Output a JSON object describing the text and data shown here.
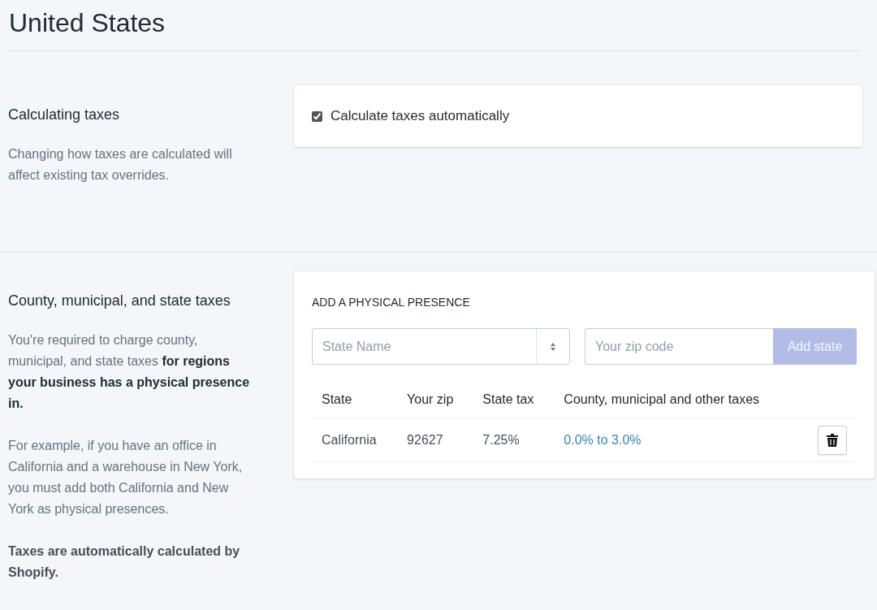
{
  "page_title": "United States",
  "sections": [
    {
      "heading": "Calculating taxes",
      "paragraphs": [
        {
          "text": "Changing how taxes are calculated will affect existing tax overrides.",
          "bold": false
        }
      ],
      "kind": "checkbox",
      "checkbox": {
        "label": "Calculate taxes automatically",
        "checked": true
      }
    },
    {
      "heading": "County, municipal, and state taxes",
      "paragraphs": [
        {
          "text": "You're required to charge county, municipal, and state taxes **for regions your business has a physical presence in.**",
          "bold": false
        },
        {
          "text": "For example, if you have an office in California and a warehouse in New York, you must add both California and New York as physical presences.",
          "bold": false
        },
        {
          "text": "Taxes are automatically calculated by Shopify.",
          "bold": true
        }
      ],
      "kind": "presence",
      "presence": {
        "title": "ADD A PHYSICAL PRESENCE",
        "state_select": {
          "placeholder": "State Name"
        },
        "zip_field": {
          "placeholder": "Your zip code"
        },
        "add_button": {
          "label": "Add state",
          "disabled": true
        },
        "columns": [
          "State",
          "Your zip",
          "State tax",
          "County, municipal and other taxes"
        ],
        "rows": [
          {
            "state": "California",
            "zip": "92627",
            "state_tax": "7.25%",
            "other_taxes": "0.0% to 3.0%"
          }
        ]
      }
    }
  ]
}
